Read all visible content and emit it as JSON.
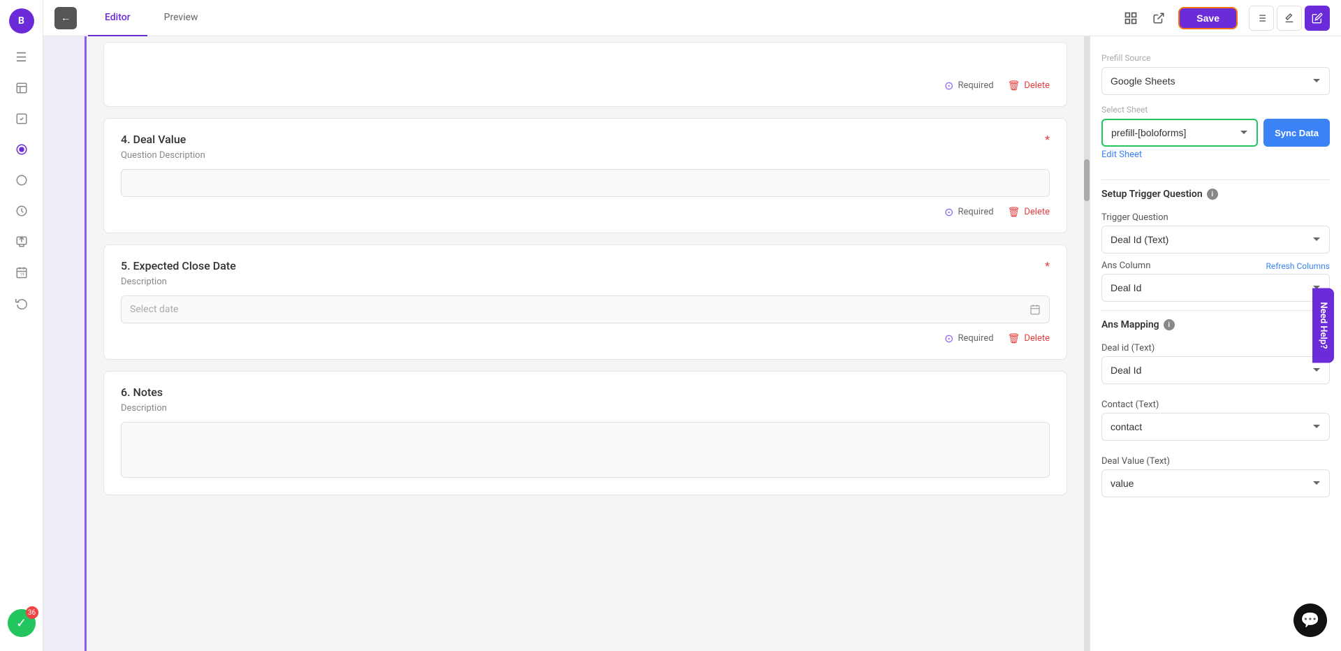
{
  "app": {
    "logo": "B",
    "logo_color": "#6c2bd9"
  },
  "topbar": {
    "back_label": "←",
    "editor_tab": "Editor",
    "preview_tab": "Preview",
    "save_label": "Save",
    "icons": [
      "⊞",
      "⤢"
    ],
    "right_icons": [
      "≡",
      "✎",
      "✎"
    ]
  },
  "sidebar": {
    "icons": [
      "☰",
      "□",
      "☑",
      "◉",
      "◎",
      "⏱",
      "⬆",
      "📅",
      "↺"
    ]
  },
  "form": {
    "question4": {
      "number": "4.",
      "title": "Deal Value",
      "description": "Question Description",
      "required": true,
      "required_label": "Required",
      "delete_label": "Delete"
    },
    "question5": {
      "number": "5.",
      "title": "Expected Close Date",
      "description": "Description",
      "date_placeholder": "Select date",
      "required": true,
      "required_label": "Required",
      "delete_label": "Delete"
    },
    "question6": {
      "number": "6.",
      "title": "Notes",
      "description": "Description"
    }
  },
  "right_panel": {
    "prefill_source_label": "Prefill Source",
    "prefill_source_value": "Google Sheets",
    "select_sheet_label": "Select Sheet",
    "select_sheet_value": "prefill-[boloforms]",
    "sync_data_label": "Sync Data",
    "edit_sheet_label": "Edit Sheet",
    "setup_trigger_label": "Setup Trigger Question",
    "trigger_question_label": "Trigger Question",
    "trigger_question_value": "Deal Id (Text)",
    "ans_column_label": "Ans Column",
    "refresh_columns_label": "Refresh Columns",
    "ans_column_value": "Deal Id",
    "ans_mapping_label": "Ans Mapping",
    "mapping": [
      {
        "label": "Deal id (Text)",
        "value": "Deal Id"
      },
      {
        "label": "Contact (Text)",
        "value": "contact"
      },
      {
        "label": "Deal Value (Text)",
        "value": "value"
      }
    ]
  },
  "need_help": "Need Help?",
  "notification_count": "36"
}
